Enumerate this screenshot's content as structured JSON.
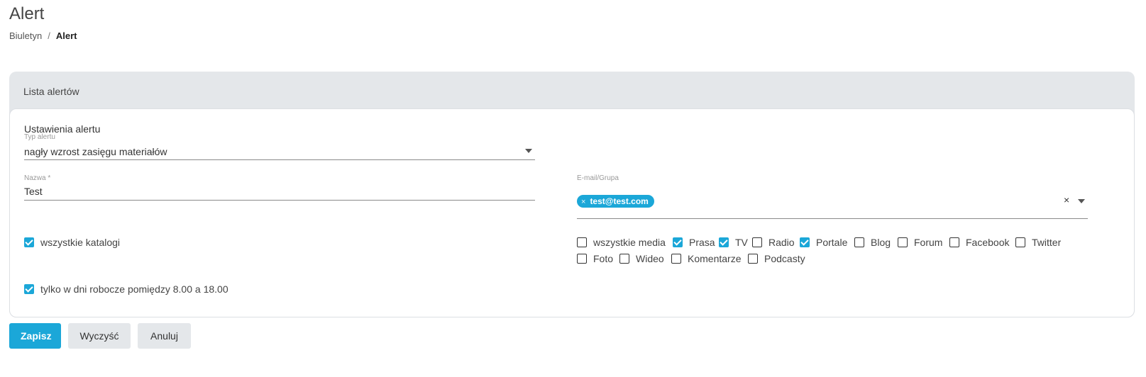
{
  "page": {
    "title": "Alert"
  },
  "breadcrumb": {
    "items": [
      "Biuletyn",
      "Alert"
    ],
    "separator": "/"
  },
  "card": {
    "header": "Lista alertów",
    "section_title": "Ustawienia alertu",
    "alert_type": {
      "label": "Typ alertu",
      "value": "nagły wzrost zasięgu materiałów"
    },
    "name": {
      "label": "Nazwa *",
      "value": "Test"
    },
    "email": {
      "label": "E-mail/Grupa",
      "chips": [
        "test@test.com"
      ],
      "chip_remove": "×",
      "clear": "×"
    },
    "all_catalogs": {
      "label": "wszystkie katalogi",
      "checked": true
    },
    "workdays": {
      "label": "tylko w dni robocze pomiędzy 8.00 a 18.00",
      "checked": true
    },
    "media": [
      {
        "label": "wszystkie media",
        "checked": false
      },
      {
        "label": "Prasa",
        "checked": true
      },
      {
        "label": "TV",
        "checked": true
      },
      {
        "label": "Radio",
        "checked": false
      },
      {
        "label": "Portale",
        "checked": true
      },
      {
        "label": "Blog",
        "checked": false
      },
      {
        "label": "Forum",
        "checked": false
      },
      {
        "label": "Facebook",
        "checked": false
      },
      {
        "label": "Twitter",
        "checked": false
      },
      {
        "label": "Foto",
        "checked": false
      },
      {
        "label": "Wideo",
        "checked": false
      },
      {
        "label": "Komentarze",
        "checked": false
      },
      {
        "label": "Podcasty",
        "checked": false
      }
    ]
  },
  "buttons": {
    "save": "Zapisz",
    "clear": "Wyczyść",
    "cancel": "Anuluj"
  },
  "colors": {
    "accent": "#1ba7d8",
    "card_bg": "#e4e7ea"
  }
}
